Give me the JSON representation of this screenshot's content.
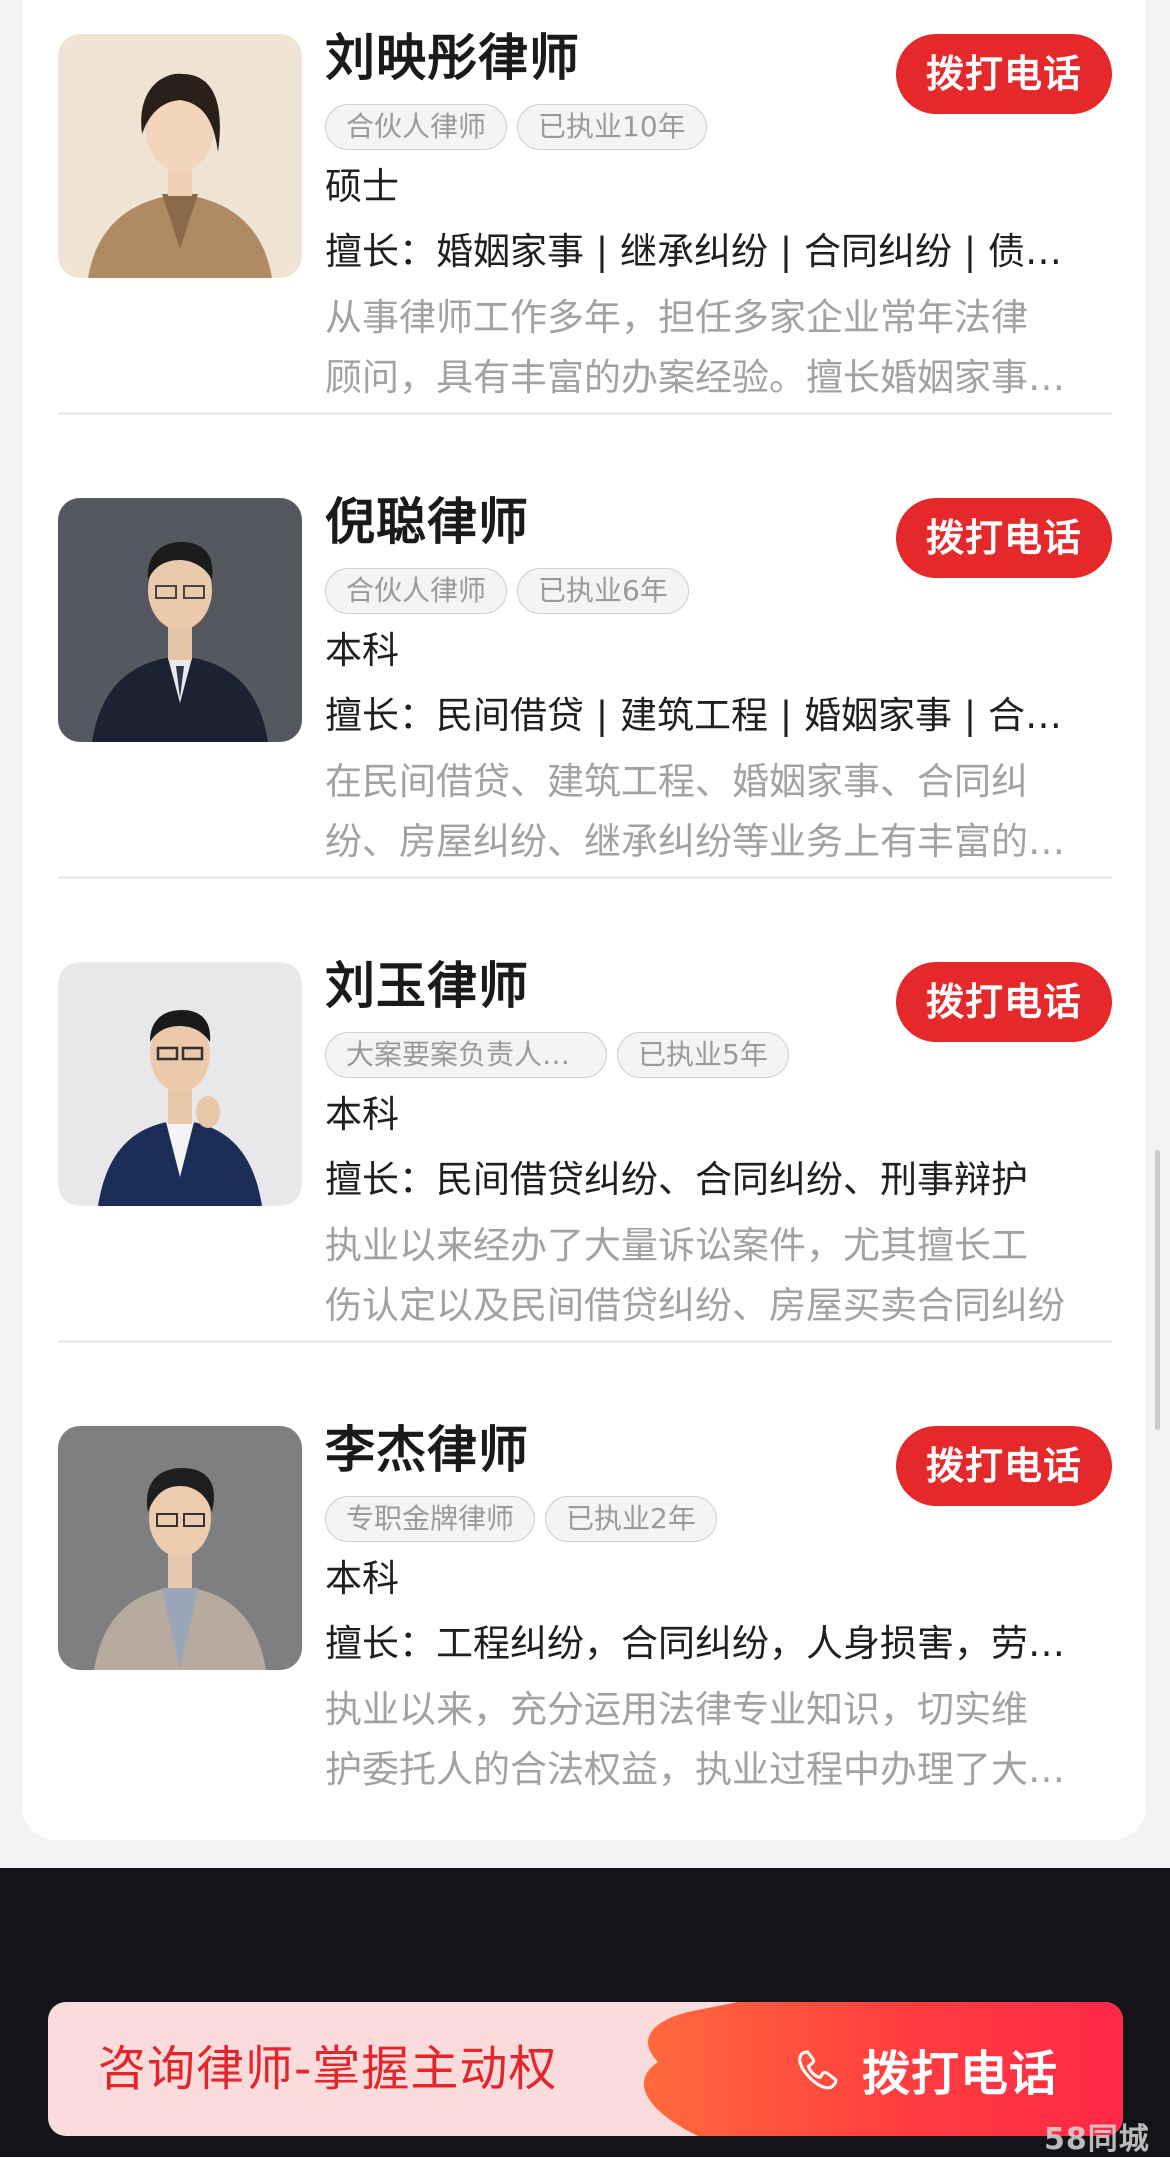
{
  "lawyers": [
    {
      "name": "刘映彤律师",
      "tags": [
        "合伙人律师",
        "已执业10年"
      ],
      "degree": "硕士",
      "specialty": "擅长：婚姻家事 | 继承纠纷 | 合同纠纷 | 债务纠纷",
      "desc_line1": "从事律师工作多年，担任多家企业常年法律",
      "desc_line2": "顾问，具有丰富的办案经验。擅长婚姻家事纠纷",
      "call_label": "拨打电话"
    },
    {
      "name": "倪聪律师",
      "tags": [
        "合伙人律师",
        "已执业6年"
      ],
      "degree": "本科",
      "specialty": "擅长：民间借贷 | 建筑工程 | 婚姻家事 | 合同纠纷",
      "desc_line1": "在民间借贷、建筑工程、婚姻家事、合同纠",
      "desc_line2": "纷、房屋纠纷、继承纠纷等业务上有丰富的经验",
      "call_label": "拨打电话"
    },
    {
      "name": "刘玉律师",
      "tags": [
        "大案要案负责人律师",
        "已执业5年"
      ],
      "degree": "本科",
      "specialty": "擅长：民间借贷纠纷、合同纠纷、刑事辩护",
      "desc_line1": "执业以来经办了大量诉讼案件，尤其擅长工",
      "desc_line2": "伤认定以及民间借贷纠纷、房屋买卖合同纠纷",
      "call_label": "拨打电话"
    },
    {
      "name": "李杰律师",
      "tags": [
        "专职金牌律师",
        "已执业2年"
      ],
      "degree": "本科",
      "specialty": "擅长：工程纠纷，合同纠纷，人身损害，劳动争议",
      "desc_line1": "执业以来，充分运用法律专业知识，切实维",
      "desc_line2": "护委托人的合法权益，执业过程中办理了大量案件",
      "call_label": "拨打电话"
    }
  ],
  "cta": {
    "text": "咨询律师-掌握主动权",
    "call_label": "拨打电话",
    "call_icon": "phone-icon"
  },
  "watermark": "58同城",
  "colors": {
    "accent": "#e5292b",
    "cta_bg": "#fbdcdc",
    "footer_bg": "#141418"
  }
}
